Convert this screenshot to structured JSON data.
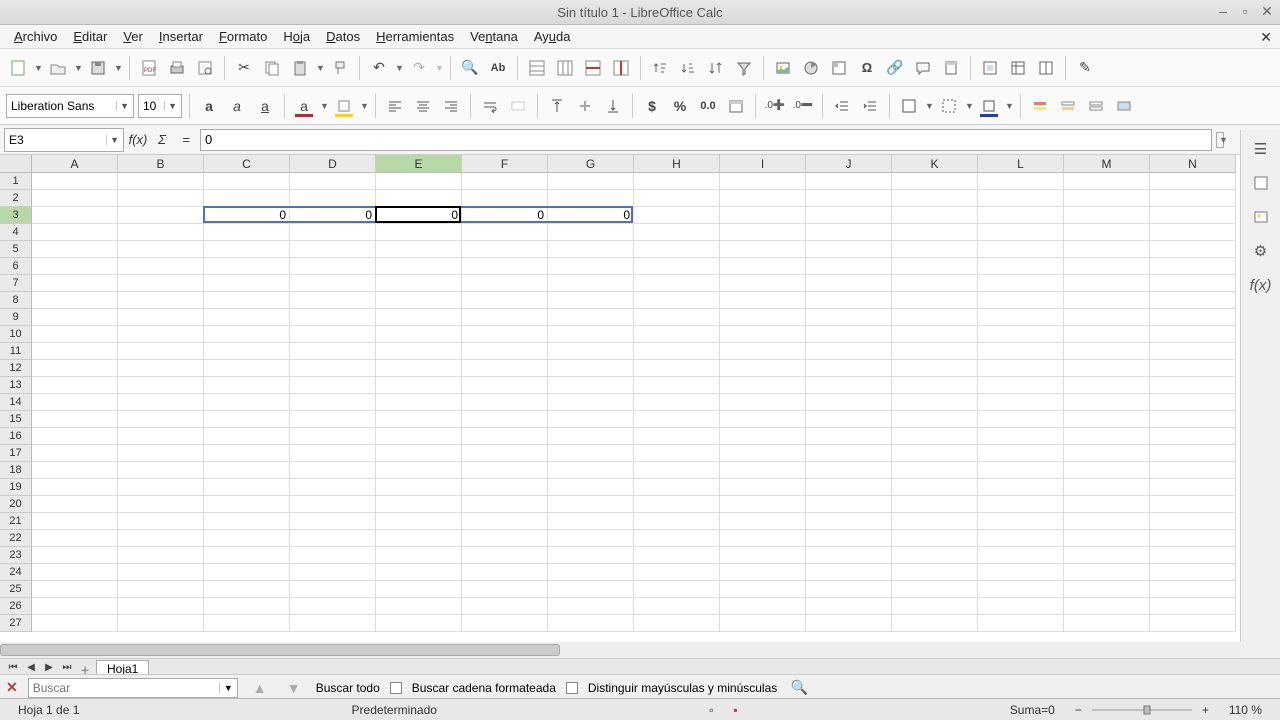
{
  "window": {
    "title": "Sin título 1 - LibreOffice Calc"
  },
  "menu": [
    "Archivo",
    "Editar",
    "Ver",
    "Insertar",
    "Formato",
    "Hoja",
    "Datos",
    "Herramientas",
    "Ventana",
    "Ayuda"
  ],
  "font": {
    "name": "Liberation Sans",
    "size": "10"
  },
  "namebox": "E3",
  "formula": "0",
  "columns": [
    "A",
    "B",
    "C",
    "D",
    "E",
    "F",
    "G",
    "H",
    "I",
    "J",
    "K",
    "L",
    "M",
    "N"
  ],
  "activeColIndex": 4,
  "rows": 27,
  "activeRowIndex": 2,
  "cellData": {
    "row": 2,
    "startCol": 2,
    "values": [
      "0",
      "0",
      "0",
      "0",
      "0"
    ]
  },
  "selection": {
    "rowIndex": 2,
    "startCol": 2,
    "endCol": 6
  },
  "activeCell": {
    "rowIndex": 2,
    "colIndex": 4
  },
  "sheet": {
    "name": "Hoja1"
  },
  "find": {
    "placeholder": "Buscar",
    "findAll": "Buscar todo",
    "formatted": "Buscar cadena formateada",
    "matchCase": "Distinguir mayúsculas y minúsculas"
  },
  "status": {
    "sheetInfo": "Hoja 1 de 1",
    "style": "Predeterminado",
    "sum": "Suma=0",
    "zoom": "110 %"
  }
}
